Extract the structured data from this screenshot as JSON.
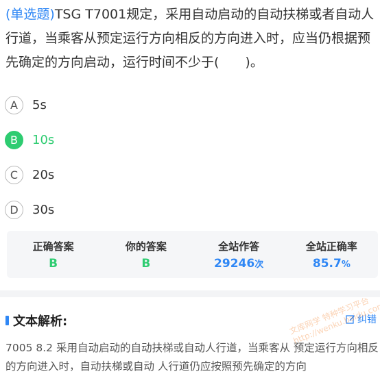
{
  "question": {
    "type_label": "(单选题)",
    "text": "TSG T7001规定，采用自动启动的自动扶梯或者自动人行道，当乘客从预定运行方向相反的方向进入时，应当仍根据预先确定的方向启动，运行时间不少于(　　)。"
  },
  "options": [
    {
      "letter": "A",
      "text": "5s",
      "state": "normal"
    },
    {
      "letter": "B",
      "text": "10s",
      "state": "correct"
    },
    {
      "letter": "C",
      "text": "20s",
      "state": "normal"
    },
    {
      "letter": "D",
      "text": "30s",
      "state": "normal"
    }
  ],
  "stats": {
    "correct_answer_label": "正确答案",
    "correct_answer": "B",
    "your_answer_label": "你的答案",
    "your_answer": "B",
    "site_attempts_label": "全站作答",
    "site_attempts": "29246",
    "site_attempts_unit": "次",
    "site_accuracy_label": "全站正确率",
    "site_accuracy": "85.7",
    "site_accuracy_unit": "%"
  },
  "analysis": {
    "title": "文本解析:",
    "report_label": "纠错",
    "text": "7005 8.2 采用自动启动的自动扶梯或自动人行道，当乘客从 预定运行方向相反的方向进入时，自动扶梯或自动 人行道仍应按照预先确定的方向"
  },
  "watermark": {
    "line1": "文库网学 特种学习平台",
    "line2": "http://wenku.baidu.com/"
  },
  "colors": {
    "accent": "#2f87f5",
    "correct": "#2ecc71"
  },
  "icons": {
    "report": "edit-icon"
  }
}
